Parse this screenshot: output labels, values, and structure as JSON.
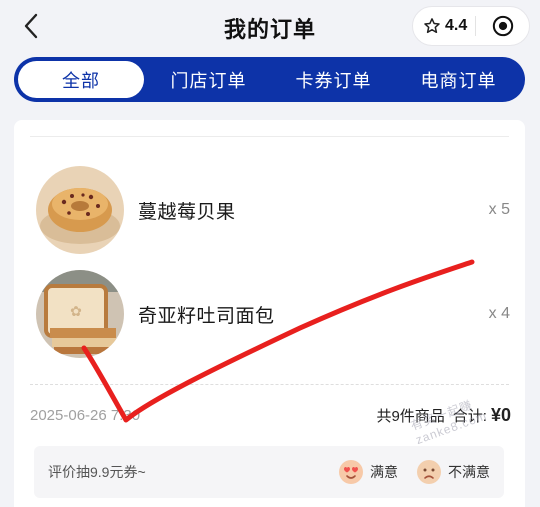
{
  "header": {
    "title": "我的订单",
    "rating": "4.4",
    "back_icon": "chevron-left-icon",
    "rating_icon": "star-outline-icon",
    "target_icon": "target-icon"
  },
  "tabs": [
    {
      "label": "全部",
      "active": true
    },
    {
      "label": "门店订单",
      "active": false
    },
    {
      "label": "卡券订单",
      "active": false
    },
    {
      "label": "电商订单",
      "active": false
    }
  ],
  "order": {
    "items": [
      {
        "name": "蔓越莓贝果",
        "qty": "x 5"
      },
      {
        "name": "奇亚籽吐司面包",
        "qty": "x 4"
      }
    ],
    "time": "2025-06-26 7:30",
    "count_text": "共9件商品",
    "total_label": "合计:",
    "amount": "¥0"
  },
  "review": {
    "text": "评价抽9.9元券~",
    "satisfied": "满意",
    "unsatisfied": "不满意"
  },
  "watermark": "有奖一起赚 zanke8.com",
  "colors": {
    "brand": "#0d33a8",
    "background": "#f2f3f7",
    "annotation": "#e8201e"
  }
}
